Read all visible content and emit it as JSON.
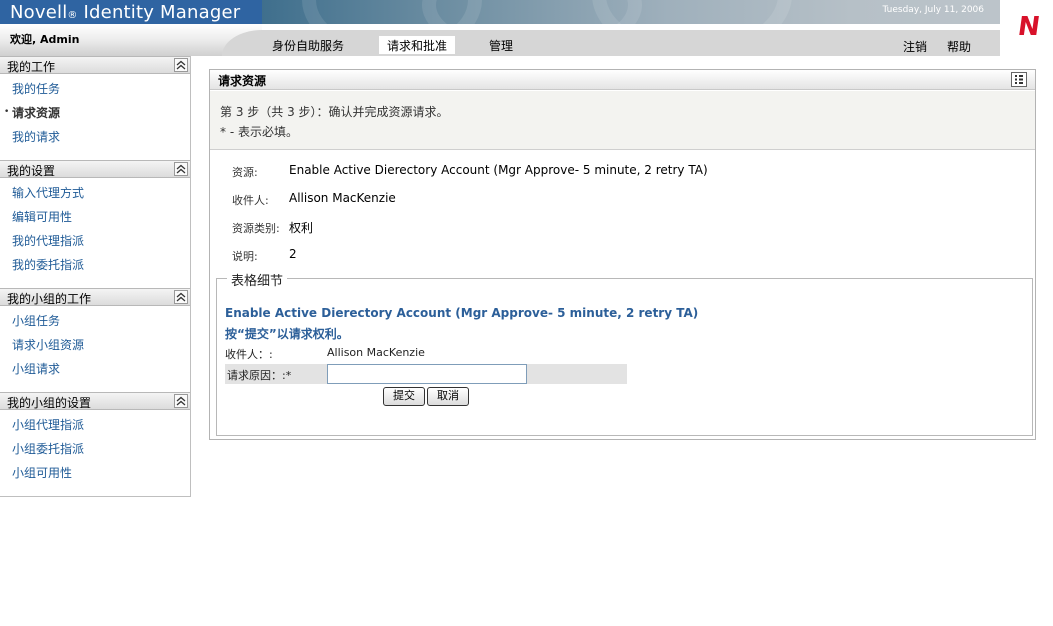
{
  "header": {
    "brand": "Novell",
    "brand_mark": "®",
    "product": "Identity Manager",
    "date": "Tuesday, July 11, 2006",
    "welcome": "欢迎, Admin",
    "logo_letter": "N",
    "brand_color": "#2f64a2",
    "logo_color": "#d8112a"
  },
  "nav": {
    "tabs": [
      {
        "label": "身份自助服务"
      },
      {
        "label": "请求和批准"
      },
      {
        "label": "管理"
      }
    ],
    "active_tab": "请求和批准",
    "logout": "注销",
    "help": "帮助"
  },
  "sidebar": {
    "sections": [
      {
        "title": "我的工作",
        "items": [
          "我的任务",
          "请求资源",
          "我的请求"
        ]
      },
      {
        "title": "我的设置",
        "items": [
          "输入代理方式",
          "编辑可用性",
          "我的代理指派",
          "我的委托指派"
        ]
      },
      {
        "title": "我的小组的工作",
        "items": [
          "小组任务",
          "请求小组资源",
          "小组请求"
        ]
      },
      {
        "title": "我的小组的设置",
        "items": [
          "小组代理指派",
          "小组委托指派",
          "小组可用性"
        ]
      }
    ],
    "current_item": "请求资源",
    "link_color": "#1e5a96"
  },
  "panel": {
    "title": "请求资源",
    "step": "第 3 步（共 3 步）：确认并完成资源请求。",
    "required_note": "* - 表示必填。",
    "details": [
      {
        "label": "资源:",
        "value": "Enable Active Dierectory Account (Mgr Approve- 5 minute, 2 retry TA)"
      },
      {
        "label": "收件人:",
        "value": "Allison MacKenzie"
      },
      {
        "label": "资源类别:",
        "value": "权利"
      },
      {
        "label": "说明:",
        "value": "2"
      }
    ]
  },
  "form": {
    "legend": "表格细节",
    "title": "Enable Active Dierectory Account (Mgr Approve- 5 minute, 2 retry TA)",
    "instruction": "按“提交”以请求权利。",
    "recipient_label": "收件人：:",
    "recipient_value": "Allison MacKenzie",
    "reason_label": "请求原因：:*",
    "reason_value": "",
    "submit": "提交",
    "cancel": "取消",
    "title_color": "#2c5f99"
  }
}
